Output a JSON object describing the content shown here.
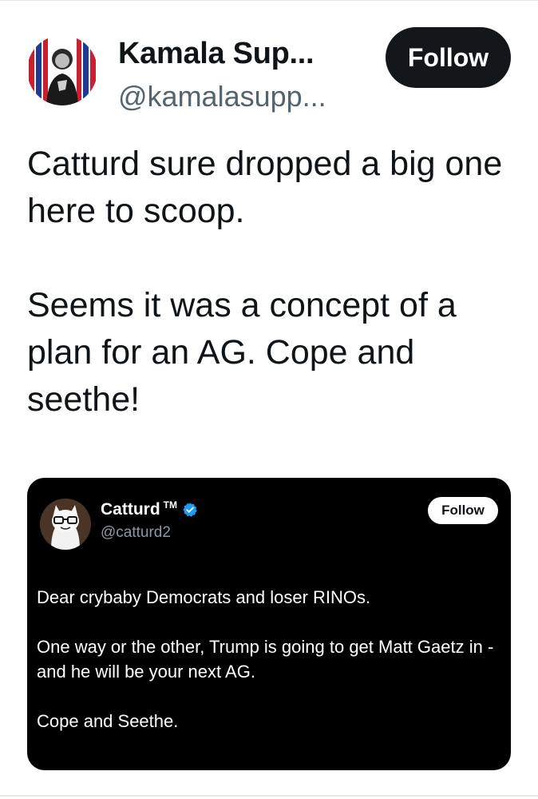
{
  "post": {
    "author_name": "Kamala Sup...",
    "author_handle": "@kamalasupp...",
    "follow_label": "Follow",
    "paragraphs": [
      "Catturd sure dropped a big one here to scoop.",
      "Seems it was a concept of a plan for an AG. Cope and seethe!"
    ]
  },
  "quoted_post": {
    "author_name": "Catturd",
    "trademark": "TM",
    "author_handle": "@catturd2",
    "follow_label": "Follow",
    "verified_icon": "verified-badge-icon",
    "paragraphs": [
      "Dear crybaby Democrats and loser RINOs.",
      "One way or the other, Trump is going to get Matt Gaetz in - and he will be your next AG.",
      "Cope and Seethe."
    ]
  },
  "colors": {
    "follow_button_bg": "#14171a",
    "quote_card_bg": "#000000",
    "verified_blue": "#1d9bf0",
    "handle_gray": "#536471"
  }
}
